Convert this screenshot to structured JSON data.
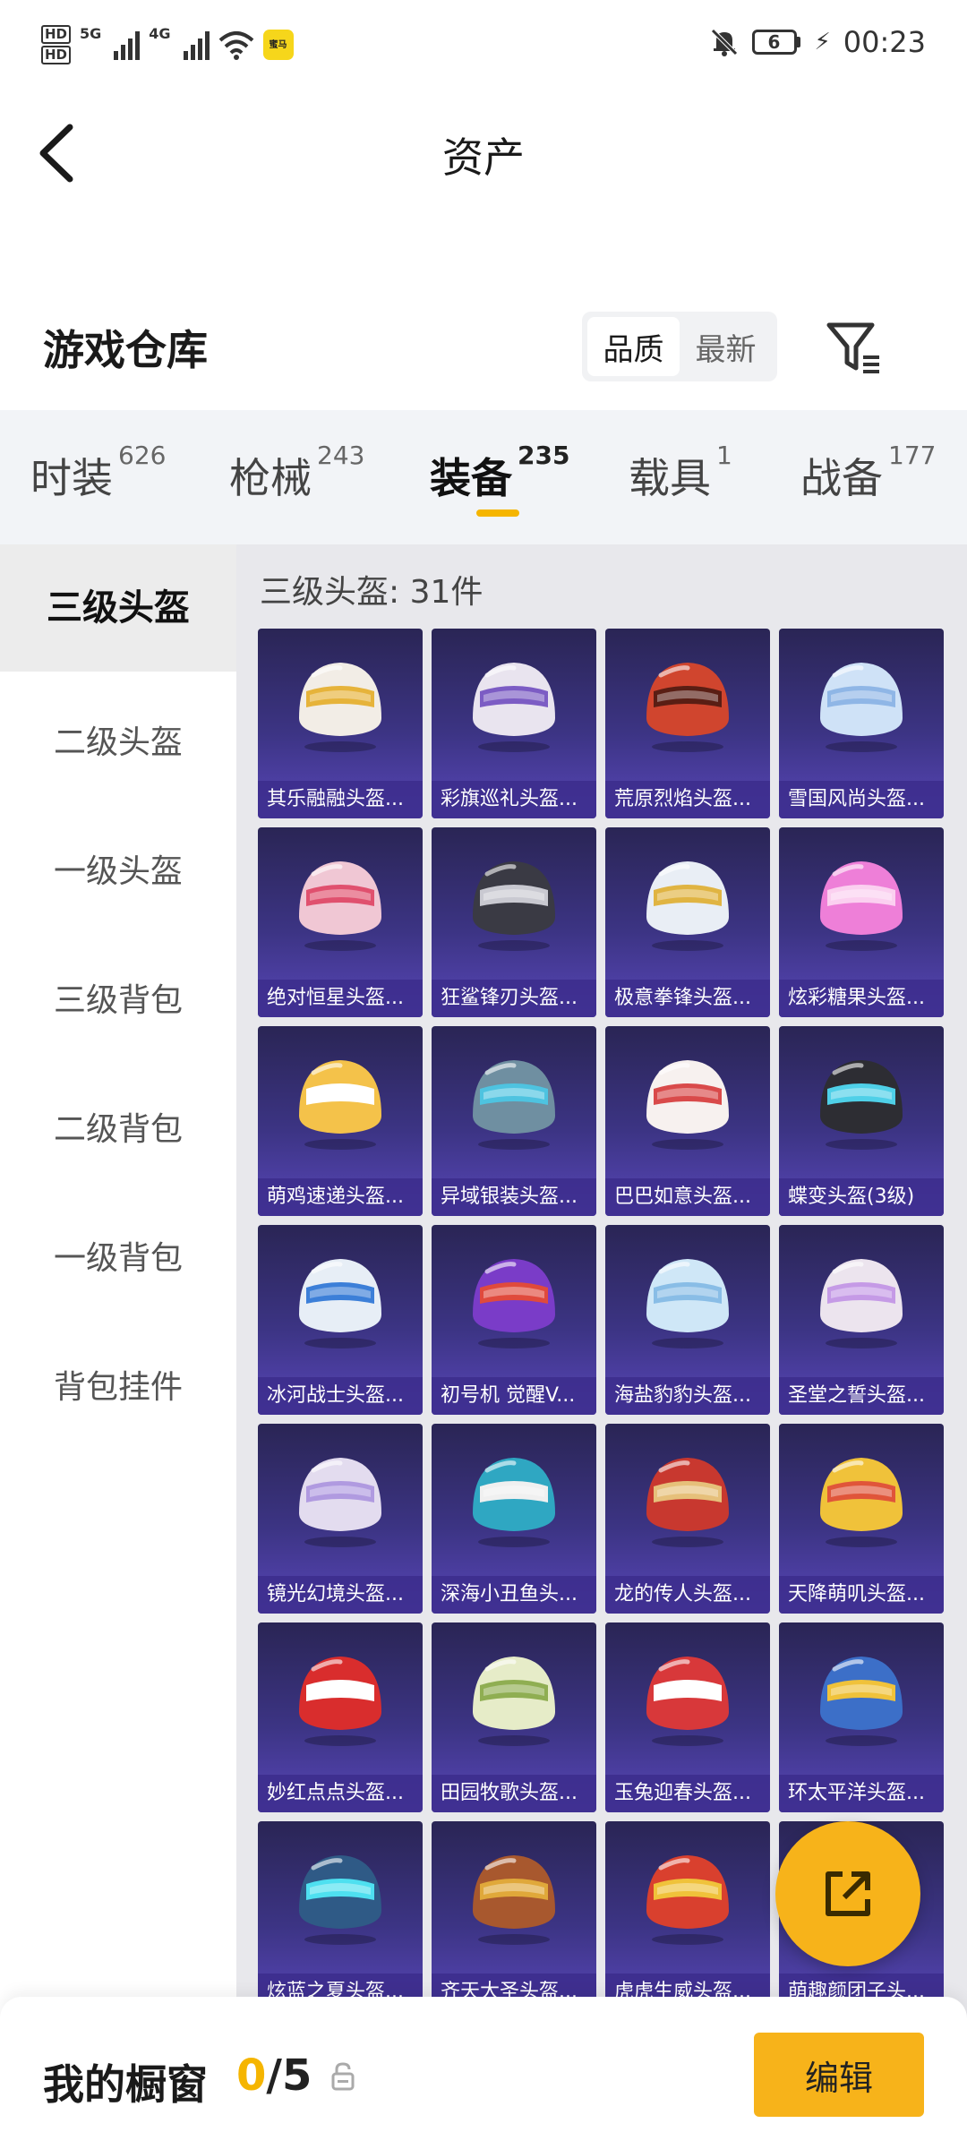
{
  "status_bar": {
    "hd_top": "HD",
    "hd_bottom": "HD",
    "net1": "5G",
    "net2": "4G",
    "app_badge": "蜜马",
    "battery": "6",
    "time": "00:23"
  },
  "header": {
    "title": "资产"
  },
  "warehouse": {
    "title": "游戏仓库",
    "sort_options": [
      "品质",
      "最新"
    ]
  },
  "tabs": [
    {
      "label": "时装",
      "count": "626"
    },
    {
      "label": "枪械",
      "count": "243"
    },
    {
      "label": "装备",
      "count": "235"
    },
    {
      "label": "载具",
      "count": "1"
    },
    {
      "label": "战备",
      "count": "177"
    }
  ],
  "side_menu": [
    {
      "label": "三级头盔"
    },
    {
      "label": "二级头盔"
    },
    {
      "label": "一级头盔"
    },
    {
      "label": "三级背包"
    },
    {
      "label": "二级背包"
    },
    {
      "label": "一级背包"
    },
    {
      "label": "背包挂件"
    }
  ],
  "grid": {
    "title": "三级头盔: 31件",
    "items": [
      {
        "name": "其乐融融头盔...",
        "color": "#f2ede6",
        "accent": "#e6b33a"
      },
      {
        "name": "彩旗巡礼头盔...",
        "color": "#e9e4ef",
        "accent": "#7c5cc4"
      },
      {
        "name": "荒原烈焰头盔...",
        "color": "#d0452e",
        "accent": "#5a1e14"
      },
      {
        "name": "雪国风尚头盔...",
        "color": "#cfe2f7",
        "accent": "#8fb6e6"
      },
      {
        "name": "绝对恒星头盔...",
        "color": "#f0c7d4",
        "accent": "#e0506e"
      },
      {
        "name": "狂鲨锋刃头盔...",
        "color": "#3a3a44",
        "accent": "#c9c9d1"
      },
      {
        "name": "极意拳锋头盔...",
        "color": "#e9eef5",
        "accent": "#e0b442"
      },
      {
        "name": "炫彩糖果头盔...",
        "color": "#ee7fd8",
        "accent": "#fbd0f0"
      },
      {
        "name": "萌鸡速递头盔...",
        "color": "#f4c24a",
        "accent": "#ffffff"
      },
      {
        "name": "异域银装头盔...",
        "color": "#6f8fa1",
        "accent": "#4ec3e0"
      },
      {
        "name": "巴巴如意头盔...",
        "color": "#f7f1ef",
        "accent": "#d94a4a"
      },
      {
        "name": "蝶变头盔(3级)",
        "color": "#2d2d33",
        "accent": "#4fd0e8"
      },
      {
        "name": "冰河战士头盔...",
        "color": "#e7eef6",
        "accent": "#3c7fd8"
      },
      {
        "name": "初号机 觉醒V...",
        "color": "#7a3cc8",
        "accent": "#e04a3c"
      },
      {
        "name": "海盐豹豹头盔...",
        "color": "#cfe7f7",
        "accent": "#89bde6"
      },
      {
        "name": "圣堂之誓头盔...",
        "color": "#ece4ee",
        "accent": "#c59ae6"
      },
      {
        "name": "镜光幻境头盔...",
        "color": "#e3dcef",
        "accent": "#b09ae0"
      },
      {
        "name": "深海小丑鱼头...",
        "color": "#2fa7c2",
        "accent": "#f0f0f0"
      },
      {
        "name": "龙的传人头盔...",
        "color": "#c8382f",
        "accent": "#e6c07a"
      },
      {
        "name": "天降萌叽头盔...",
        "color": "#f0c23a",
        "accent": "#e0553a"
      },
      {
        "name": "妙红点点头盔...",
        "color": "#d92d2d",
        "accent": "#ffffff"
      },
      {
        "name": "田园牧歌头盔...",
        "color": "#e6ecc8",
        "accent": "#8fae52"
      },
      {
        "name": "玉兔迎春头盔...",
        "color": "#d8383a",
        "accent": "#ffffff"
      },
      {
        "name": "环太平洋头盔...",
        "color": "#3c6fc8",
        "accent": "#f0c23a"
      },
      {
        "name": "炫蓝之夏头盔...",
        "color": "#2f5a86",
        "accent": "#4ee0f0"
      },
      {
        "name": "齐天大圣头盔...",
        "color": "#a8582e",
        "accent": "#e0a83a"
      },
      {
        "name": "虎虎生威头盔...",
        "color": "#d9402e",
        "accent": "#f0c23a"
      },
      {
        "name": "萌趣颜团子头...",
        "color": "#8ed050",
        "accent": "#f0f0f0"
      }
    ]
  },
  "bottom_bar": {
    "title": "我的橱窗",
    "count_current": "0",
    "count_sep": "/5",
    "edit_label": "编辑"
  }
}
